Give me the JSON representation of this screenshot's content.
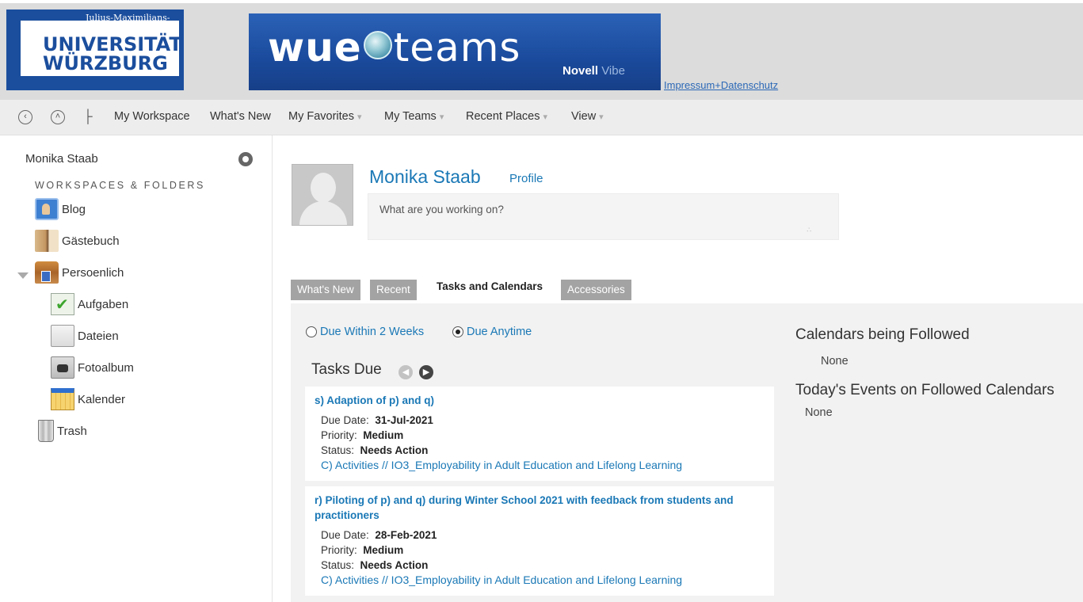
{
  "header": {
    "uni_small": "Julius-Maximilians-",
    "uni_line1": "UNIVERSITÄT",
    "uni_line2": "WÜRZBURG",
    "brand_prefix": "wue",
    "brand_suffix": "teams",
    "brand_novell": "Novell",
    "brand_vibe": "Vibe",
    "impressum_link": "Impressum+Datenschutz"
  },
  "toolbar": {
    "back_icon": "back-circle-icon",
    "up_icon": "up-circle-icon",
    "tree_icon": "tree-icon",
    "items": [
      {
        "label": "My Workspace",
        "caret": ""
      },
      {
        "label": "What's New",
        "caret": ""
      },
      {
        "label": "My Favorites",
        "caret": "▾"
      },
      {
        "label": "My Teams",
        "caret": "▾"
      },
      {
        "label": "Recent Places",
        "caret": "▾"
      },
      {
        "label": "View",
        "caret": "▾"
      }
    ]
  },
  "sidebar": {
    "user": "Monika Staab",
    "section": "WORKSPACES & FOLDERS",
    "items": [
      {
        "label": "Blog",
        "icon": "blog-icon"
      },
      {
        "label": "Gästebuch",
        "icon": "guestbook-icon"
      },
      {
        "label": "Persoenlich",
        "icon": "personal-workspace-icon"
      },
      {
        "label": "Aufgaben",
        "icon": "tasks-icon"
      },
      {
        "label": "Dateien",
        "icon": "folder-icon"
      },
      {
        "label": "Fotoalbum",
        "icon": "photo-album-icon"
      },
      {
        "label": "Kalender",
        "icon": "calendar-icon"
      },
      {
        "label": "Trash",
        "icon": "trash-icon"
      }
    ]
  },
  "profile": {
    "name": "Monika Staab",
    "profile_link": "Profile",
    "status_placeholder": "What are you working on?"
  },
  "tabs": [
    {
      "label": "What's New",
      "active": false
    },
    {
      "label": "Recent",
      "active": false
    },
    {
      "label": "Tasks and Calendars",
      "active": true
    },
    {
      "label": "Accessories",
      "active": false
    }
  ],
  "filters": {
    "within_2_weeks": "Due Within 2 Weeks",
    "anytime": "Due Anytime",
    "selected": "anytime"
  },
  "tasks": {
    "header": "Tasks Due",
    "due_label": "Due Date:",
    "priority_label": "Priority:",
    "status_label": "Status:",
    "items": [
      {
        "title": "s) Adaption of p) and q)",
        "due": "31-Jul-2021",
        "priority": "Medium",
        "status": "Needs Action",
        "link": "C) Activities // IO3_Employability in Adult Education and Lifelong Learning"
      },
      {
        "title": "r) Piloting of p) and q) during Winter School 2021 with feedback from students and practitioners",
        "due": "28-Feb-2021",
        "priority": "Medium",
        "status": "Needs Action",
        "link": "C) Activities // IO3_Employability in Adult Education and Lifelong Learning"
      }
    ]
  },
  "calendars": {
    "followed_header": "Calendars being Followed",
    "followed_value": "None",
    "events_header": "Today's Events on Followed Calendars",
    "events_value": "None"
  },
  "colors": {
    "link": "#1a78b6",
    "brand_blue": "#1b4e9d",
    "tab_inactive": "#a3a3a3"
  }
}
